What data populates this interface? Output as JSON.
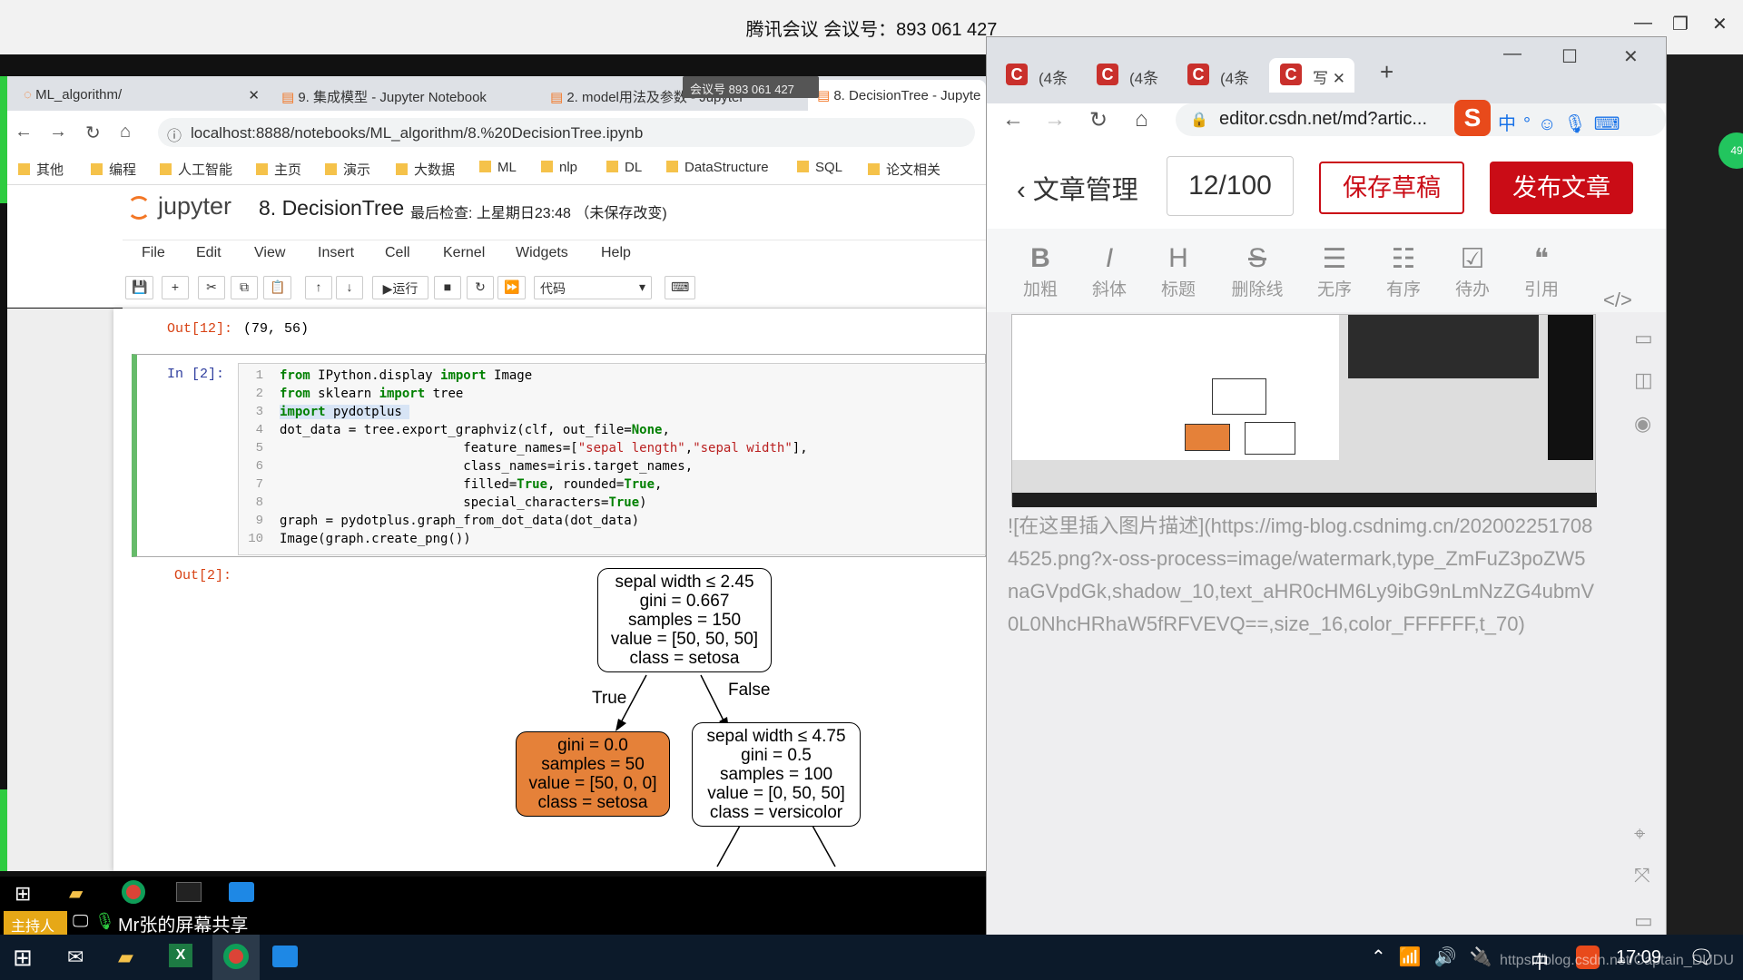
{
  "meeting": {
    "title": "腾讯会议 会议号：893 061 427"
  },
  "left_browser": {
    "tabs": [
      "ML_algorithm/",
      "9. 集成模型 - Jupyter Notebook",
      "2. model用法及参数 - Jupyter",
      "8. DecisionTree - Jupyte"
    ],
    "meeting_chip": "会议号 893 061 427",
    "url": "localhost:8888/notebooks/ML_algorithm/8.%20DecisionTree.ipynb",
    "bookmarks": [
      "其他",
      "编程",
      "人工智能",
      "主页",
      "演示",
      "大数据",
      "ML",
      "nlp",
      "DL",
      "DataStructure",
      "SQL",
      "论文相关"
    ]
  },
  "jupyter": {
    "logo": "jupyter",
    "notebook_title": "8. DecisionTree",
    "status": "最后检查: 上星期日23:48 （未保存改变)",
    "menu": [
      "File",
      "Edit",
      "View",
      "Insert",
      "Cell",
      "Kernel",
      "Widgets",
      "Help"
    ],
    "run_label": "运行",
    "cell_type": "代码",
    "prev_out_prompt": "Out[12]:",
    "prev_out_value": "(79, 56)",
    "in_prompt": "In  [2]:",
    "out_prompt": "Out[2]:",
    "line_numbers": [
      "1",
      "2",
      "3",
      "4",
      "5",
      "6",
      "7",
      "8",
      "9",
      "10"
    ],
    "tree": {
      "root": [
        "sepal width ≤ 2.45",
        "gini = 0.667",
        "samples = 150",
        "value = [50, 50, 50]",
        "class = setosa"
      ],
      "left": [
        "gini = 0.0",
        "samples = 50",
        "value = [50, 0, 0]",
        "class = setosa"
      ],
      "right": [
        "sepal width ≤ 4.75",
        "gini = 0.5",
        "samples = 100",
        "value = [0, 50, 50]",
        "class = versicolor"
      ],
      "true_label": "True",
      "false_label": "False"
    }
  },
  "share": {
    "host": "主持人",
    "label": "Mr张的屏幕共享"
  },
  "right_browser": {
    "tabs": [
      "(4条",
      "(4条",
      "(4条",
      "写"
    ],
    "url": "editor.csdn.net/md?artic...",
    "back_label": "文章管理",
    "count": "12/100",
    "save_label": "保存草稿",
    "publish_label": "发布文章",
    "format_buttons": [
      {
        "glyph": "B",
        "label": "加粗"
      },
      {
        "glyph": "I",
        "label": "斜体"
      },
      {
        "glyph": "H",
        "label": "标题"
      },
      {
        "glyph": "S",
        "label": "删除线"
      },
      {
        "glyph": "☰",
        "label": "无序"
      },
      {
        "glyph": "☷",
        "label": "有序"
      },
      {
        "glyph": "☑",
        "label": "待办"
      },
      {
        "glyph": "❝",
        "label": "引用"
      }
    ],
    "md_text": "![在这里插入图片描述](https://img-blog.csdnimg.cn/2020022517084525.png?x-oss-process=image/watermark,type_ZmFuZ3poZW5naGVpdGk,shadow_10,text_aHR0cHM6Ly9ibG9nLmNzZG4ubmV0L0NhcHRhaW5fRFVEVQ==,size_16,color_FFFFFF,t_70)"
  },
  "taskbar": {
    "time": "17:09",
    "ime": "中",
    "watermark": "https://blog.csdn.net/Captain_DUDU"
  }
}
